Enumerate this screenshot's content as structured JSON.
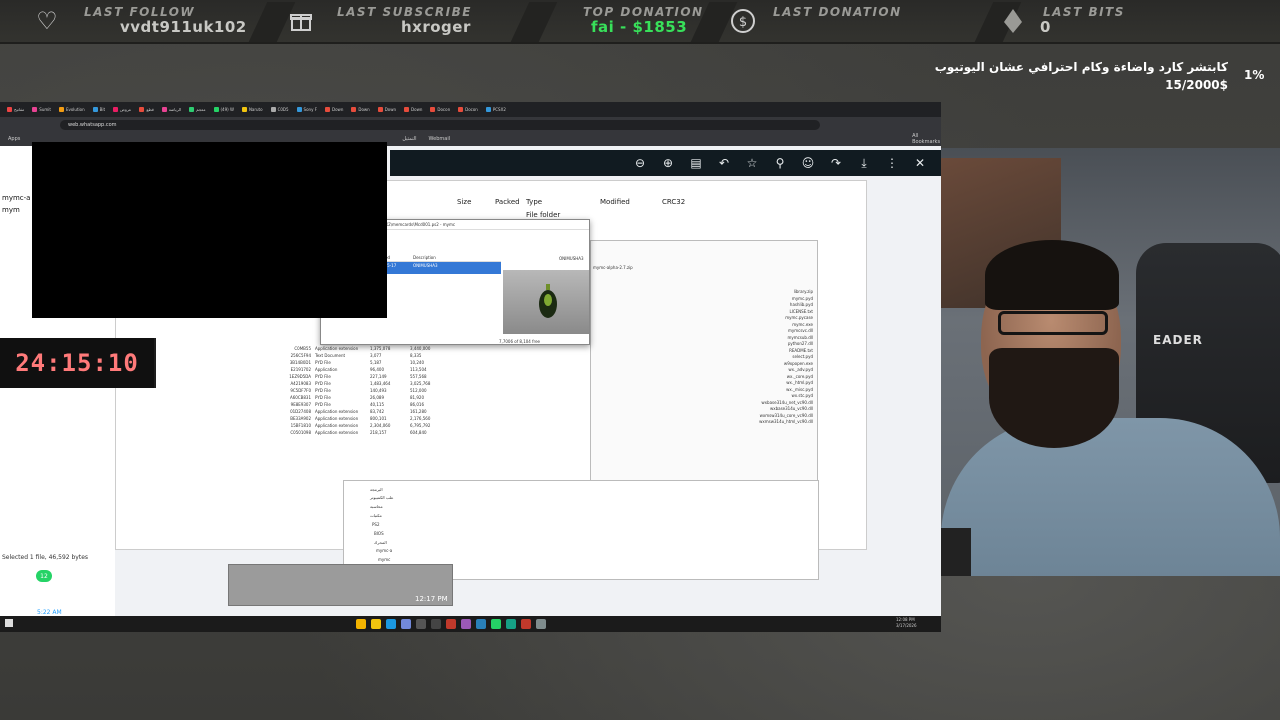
{
  "alerts": [
    {
      "label": "LAST FOLLOW",
      "value": "vvdt911uk102",
      "icon": "heart-icon"
    },
    {
      "label": "LAST SUBSCRIBE",
      "value": "hxroger",
      "icon": "gift-icon"
    },
    {
      "label": "TOP DONATION",
      "value": "fai - $1853",
      "icon": "none"
    },
    {
      "label": "LAST DONATION",
      "value": "",
      "icon": "dollar-icon"
    },
    {
      "label": "LAST BITS",
      "value": "0",
      "icon": "gem-icon"
    }
  ],
  "goal": {
    "title": "كابتشر كارد واضاءة وكام احترافي عشان اليوتيوب",
    "amount": "15/2000$",
    "percent": "1%"
  },
  "timer": {
    "value": "24:15:10"
  },
  "browser": {
    "url": "web.whatsapp.com",
    "bookmarks": [
      "Apps",
      "التمثيل",
      "Webmail",
      "All Bookmarks"
    ],
    "tabs": [
      "مفاتيح",
      "Sumit",
      "Evolution",
      "Bit",
      "عروض",
      "قطع",
      "الرياضة",
      "معجم",
      "(49) W",
      "Naruto",
      "C0D5",
      "Sony F",
      "Down",
      "Down",
      "Down",
      "Down",
      "Docon",
      "Docon",
      "PCSX2"
    ]
  },
  "whatsapp": {
    "left_items": [
      "mymc-a",
      "mym"
    ],
    "status_text": "Selected 1 file, 46,592 bytes",
    "unread_badge": "12",
    "time_left": "5:22 AM"
  },
  "explorer": {
    "columns": [
      "Size",
      "Packed",
      "Type",
      "Modified",
      "CRC32"
    ],
    "first_row_type": "File folder",
    "rows": [
      {
        "name": "C0MB55",
        "size": "3.19 4/20/2020",
        "type": "Application extension",
        "a": "1,375,078",
        "b": "3,440,000"
      },
      {
        "name": "256C5F94",
        "size": "7.32 2/5/2022",
        "type": "Text Document",
        "a": "3,077",
        "b": "8,335"
      },
      {
        "name": "3B14B0D1",
        "size": "4.13 1/14/2022",
        "type": "PYD File",
        "a": "5,187",
        "b": "10,240"
      },
      {
        "name": "E2191702",
        "size": "3.20 4/20/2020",
        "type": "Application",
        "a": "96,400",
        "b": "113,504"
      },
      {
        "name": "1EZ9D5DA",
        "size": "4.13 1/14/2022",
        "type": "PYD File",
        "a": "227,149",
        "b": "557,568"
      },
      {
        "name": "A4219083",
        "size": "4.13 1/14/2022",
        "type": "PYD File",
        "a": "1,483,464",
        "b": "3,025,768"
      },
      {
        "name": "9C5DF7F0",
        "size": "4.13 1/14/2022",
        "type": "PYD File",
        "a": "140,493",
        "b": "512,000"
      },
      {
        "name": "A60CB831",
        "size": "4.13 1/14/2022",
        "type": "PYD File",
        "a": "26,089",
        "b": "81,920"
      },
      {
        "name": "9E8E9307",
        "size": "4.13 1/14/2022",
        "type": "PYD File",
        "a": "40,115",
        "b": "86,016"
      },
      {
        "name": "01D27408",
        "size": "4.13 1/14/2022",
        "type": "Application extension",
        "a": "83,742",
        "b": "161,280"
      },
      {
        "name": "BE33A902",
        "size": "4.13 1/14/2022",
        "type": "Application extension",
        "a": "800,101",
        "b": "2,176,560"
      },
      {
        "name": "15BF1810",
        "size": "4.13 1/14/2022",
        "type": "Application extension",
        "a": "2,304,060",
        "b": "6,795,792"
      },
      {
        "name": "C0501098",
        "size": "4.13 1/14/2022",
        "type": "Application extension",
        "a": "218,157",
        "b": "604,840"
      }
    ],
    "footer_total": "24,094,129",
    "footer_sel": "46,592"
  },
  "arabic_panel": {
    "path": "mymc-alpha-2.7.zip",
    "files": [
      "library.zip",
      "mymc.pyd",
      "hashlib.pyd",
      "LICENSE.txt",
      "mymc.pycase",
      "mymc.exe",
      "mymcsvc.dll",
      "mymcsub.dll",
      "python27.dll",
      "README.txt",
      "select.pyd",
      "w9xpopen.exe",
      "wx._adv.pyd",
      "wx._core.pyd",
      "wx._html.pyd",
      "wx._misc.pyd",
      "wx.stc.pyd",
      "wxbase314u_net_vc90.dll",
      "wxbase314u_vc90.dll",
      "wxmsw314u_core_vc90.dll",
      "wxmsw314u_html_vc90.dll"
    ]
  },
  "mymc": {
    "title": "C:\\Users\\User\\Documents\\PCSX2\\memcards\\Mcd001.ps2 - mymc",
    "menu": [
      "File",
      "Options"
    ],
    "list_headers": [
      "Directory",
      "S...",
      "Modified",
      "Description"
    ],
    "selected": [
      "BESLES-51914",
      "378K",
      "2020-05-17 17:36",
      "ONIMUSHA3"
    ],
    "icon_caption": "ONIMUSHA3",
    "footer": "7,7006 of 8,104 free"
  },
  "tree": {
    "items": [
      "البرمجة",
      "علب الكمبيوتر",
      "محاسبة",
      "مكتبات",
      "PS2",
      "BIOS",
      "المحرك",
      "mymc-a",
      "mymc",
      "العاب بالاسمية"
    ],
    "footer": "42 items   1 item selected 1.63 MB"
  },
  "thumb_time": "12:17 PM",
  "taskbar_clock": [
    "12:08 PM",
    "3/17/2026"
  ],
  "webcam": {
    "chair_text": "EADER"
  },
  "colors": {
    "green_value": "#38e05a",
    "timer_red": "#ff7a7a",
    "wa_green": "#25d366"
  }
}
